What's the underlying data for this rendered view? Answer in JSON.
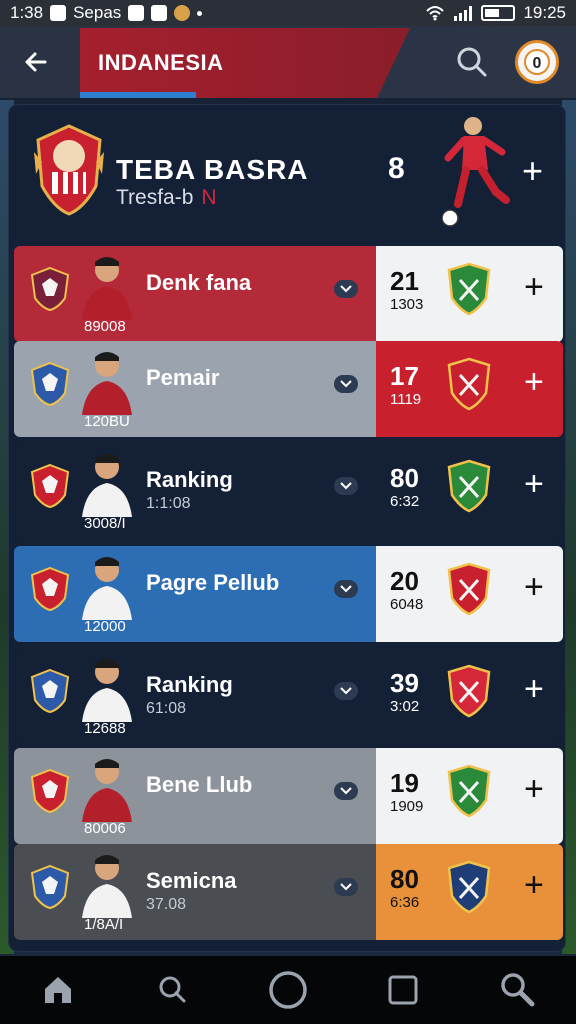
{
  "status_bar": {
    "time": "1:38",
    "carrier": "Sepas",
    "clock": "19:25"
  },
  "header": {
    "title": "INDANESIA"
  },
  "hero": {
    "team_name": "TEBA BASRA",
    "subtitle": "Tresfa-b",
    "subtitle_accent": "N",
    "count": "8"
  },
  "rows": [
    {
      "num": "89008",
      "name": "Denk fana",
      "time": "",
      "score": "21",
      "score_sub": "1303",
      "left_bg": "#b42a38",
      "right_bg": "#f1f2f4",
      "right_text": "#111",
      "left_shirt": "#b3202c"
    },
    {
      "num": "120BU",
      "name": "Pemair",
      "time": "",
      "score": "17",
      "score_sub": "1119",
      "left_bg": "#9aa3ae",
      "right_bg": "#c9202e",
      "right_text": "#fff",
      "left_shirt": "#b3202c"
    },
    {
      "num": "3008/I",
      "name": "Ranking",
      "time": "1:1:08",
      "score": "80",
      "score_sub": "6:32",
      "left_bg": "#132036",
      "right_bg": "#132036",
      "right_text": "#fff",
      "left_shirt": "#f2f2f2"
    },
    {
      "num": "12000",
      "name": "Pagre Pellub",
      "time": "",
      "score": "20",
      "score_sub": "6048",
      "left_bg": "#2d6db4",
      "right_bg": "#f1f2f4",
      "right_text": "#111",
      "left_shirt": "#f2f2f2"
    },
    {
      "num": "12688",
      "name": "Ranking",
      "time": "61:08",
      "score": "39",
      "score_sub": "3:02",
      "left_bg": "#132036",
      "right_bg": "#132036",
      "right_text": "#fff",
      "left_shirt": "#f2f2f2"
    },
    {
      "num": "80006",
      "name": "Bene Llub",
      "time": "",
      "score": "19",
      "score_sub": "1909",
      "left_bg": "#8d939b",
      "right_bg": "#f1f2f4",
      "right_text": "#111",
      "left_shirt": "#b3202c"
    },
    {
      "num": "1/8A/I",
      "name": "Semicna",
      "time": "37.08",
      "score": "80",
      "score_sub": "6:36",
      "left_bg": "#4a4d52",
      "right_bg": "#e8913a",
      "right_text": "#111",
      "left_shirt": "#f2f2f2"
    }
  ],
  "colors": {
    "accent_red": "#a51f2e",
    "accent_blue": "#2e7fd0",
    "accent_orange": "#e08a2a"
  },
  "icons": {
    "back": "arrow-left-icon",
    "search": "search-icon",
    "nav": [
      "home-icon",
      "search-icon",
      "circle-home-icon",
      "square-recent-icon",
      "magnify-icon"
    ]
  }
}
